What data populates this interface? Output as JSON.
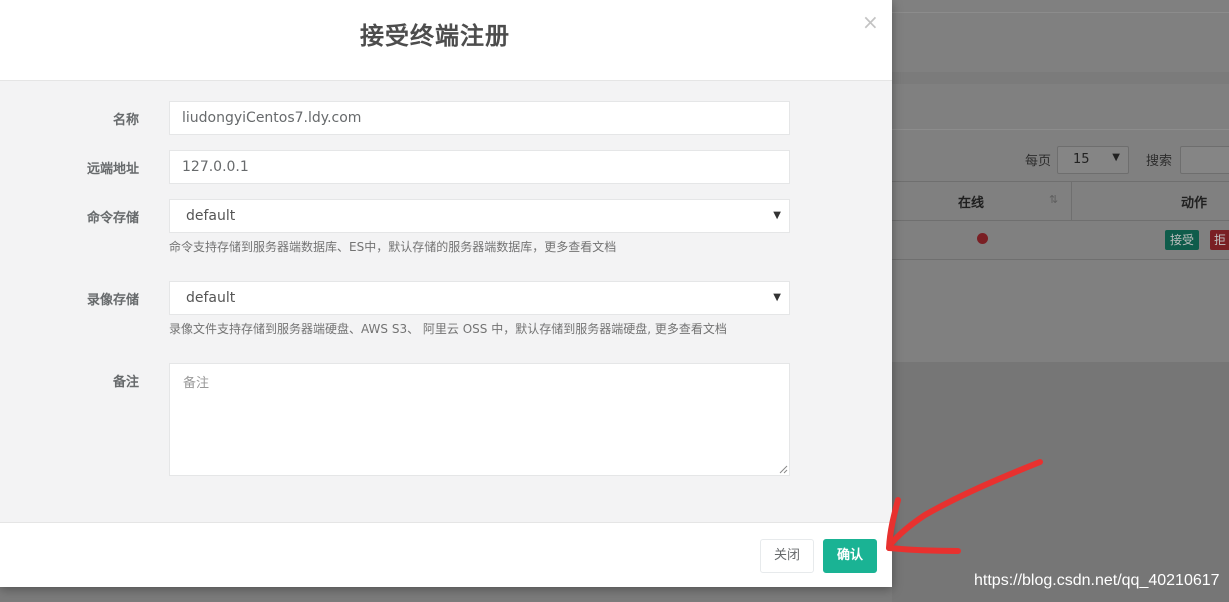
{
  "modal": {
    "title": "接受终端注册",
    "close_symbol": "×"
  },
  "form": {
    "name": {
      "label": "名称",
      "value": "liudongyiCentos7.ldy.com"
    },
    "remote_address": {
      "label": "远端地址",
      "value": "127.0.0.1"
    },
    "command_storage": {
      "label": "命令存储",
      "selected": "default",
      "help": "命令支持存储到服务器端数据库、ES中，默认存储的服务器端数据库，更多查看文档"
    },
    "replay_storage": {
      "label": "录像存储",
      "selected": "default",
      "help": "录像文件支持存储到服务器端硬盘、AWS S3、 阿里云 OSS 中，默认存储到服务器端硬盘, 更多查看文档"
    },
    "comment": {
      "label": "备注",
      "placeholder": "备注"
    }
  },
  "footer": {
    "close_label": "关闭",
    "confirm_label": "确认"
  },
  "background": {
    "per_page_label": "每页",
    "per_page_value": "15",
    "search_label": "搜索",
    "columns": {
      "online": "在线",
      "action": "动作"
    },
    "row": {
      "accept_label": "接受",
      "reject_label": "拒"
    }
  },
  "watermark": "https://blog.csdn.net/qq_40210617",
  "colors": {
    "primary": "#1ab394",
    "offline_dot": "#ed5565",
    "annotation_arrow": "#e8312f"
  }
}
